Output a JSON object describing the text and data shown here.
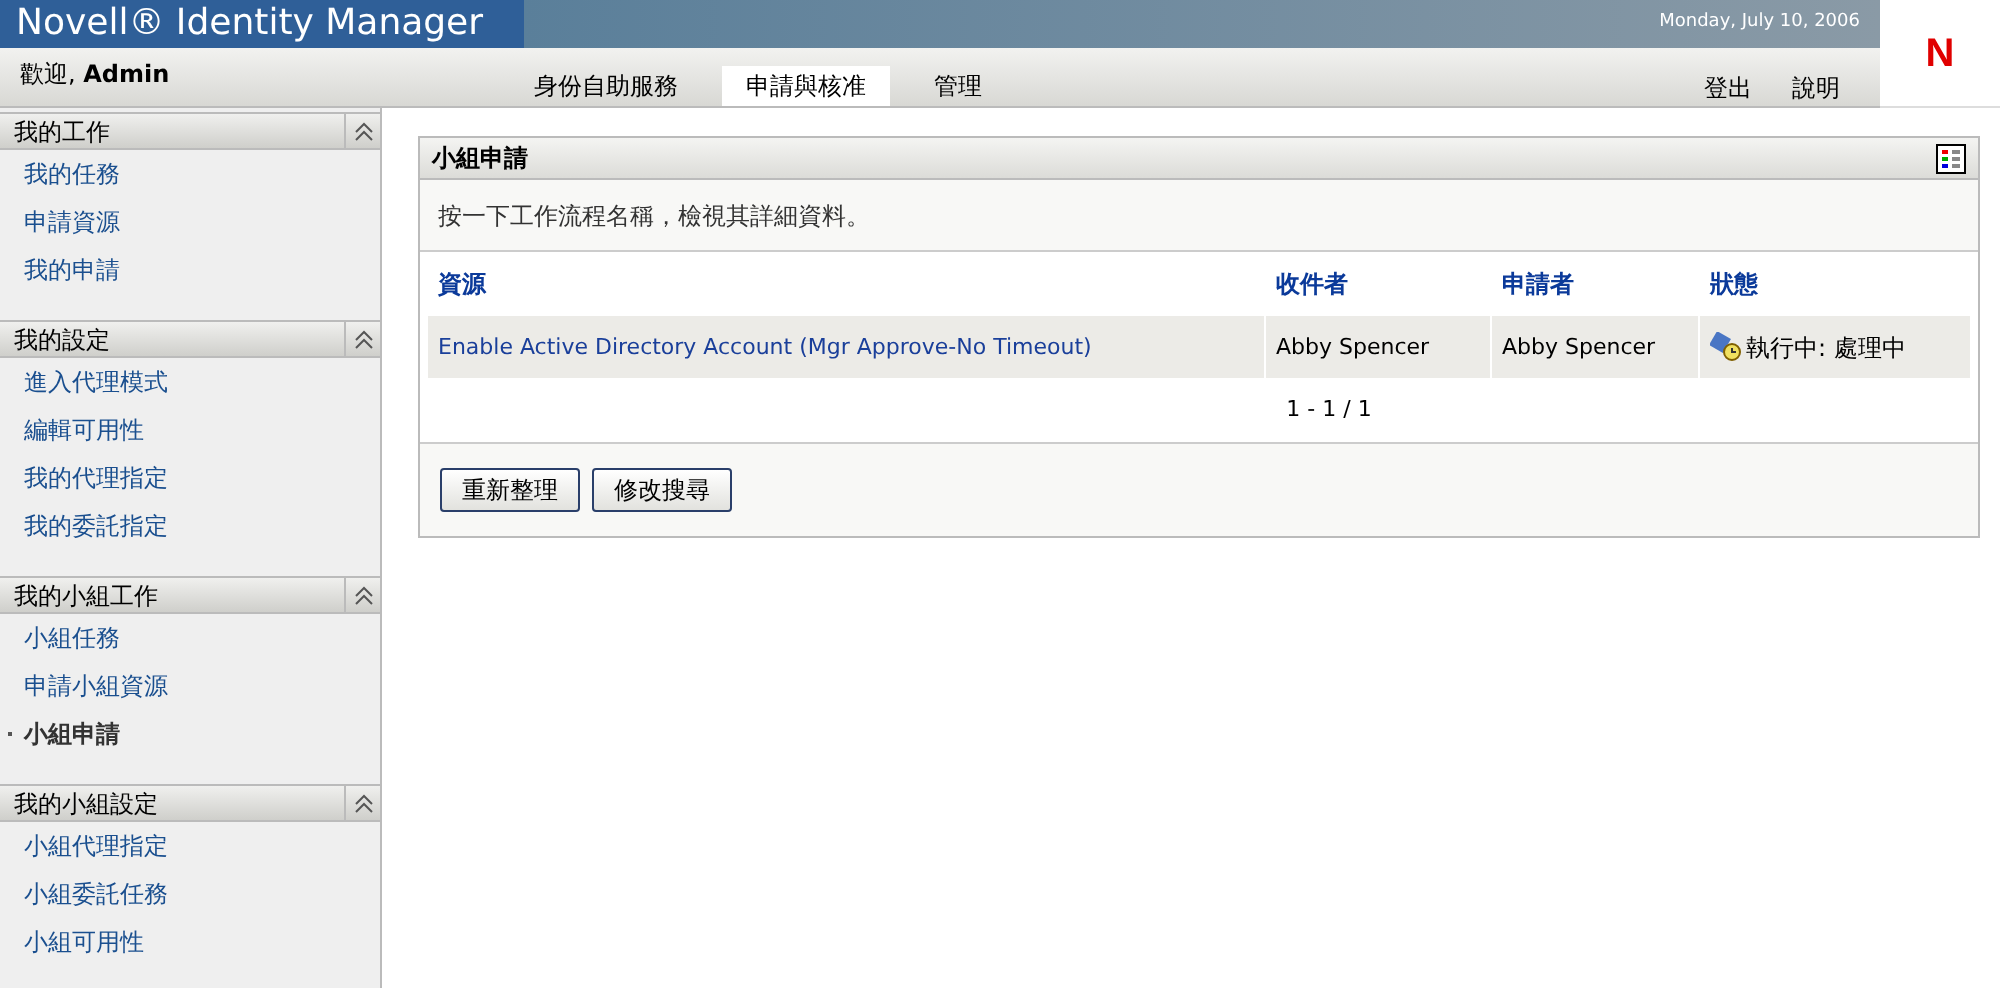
{
  "header": {
    "title": "Novell® Identity Manager",
    "date": "Monday, July 10, 2006",
    "logo": "N",
    "welcome": "歡迎, **Admin**"
  },
  "tabs": [
    {
      "label": "身份自助服務",
      "selected": false
    },
    {
      "label": "申請與核准",
      "selected": true
    },
    {
      "label": "管理",
      "selected": false
    }
  ],
  "header_links": [
    "登出",
    "說明"
  ],
  "sidebar": [
    {
      "title": "我的工作",
      "expanded": true,
      "items": [
        {
          "label": "我的任務",
          "selected": false
        },
        {
          "label": "申請資源",
          "selected": false
        },
        {
          "label": "我的申請",
          "selected": false
        }
      ]
    },
    {
      "title": "我的設定",
      "expanded": true,
      "items": [
        {
          "label": "進入代理模式",
          "selected": false
        },
        {
          "label": "編輯可用性",
          "selected": false
        },
        {
          "label": "我的代理指定",
          "selected": false
        },
        {
          "label": "我的委託指定",
          "selected": false
        }
      ]
    },
    {
      "title": "我的小組工作",
      "expanded": true,
      "items": [
        {
          "label": "小組任務",
          "selected": false
        },
        {
          "label": "申請小組資源",
          "selected": false
        },
        {
          "label": "小組申請",
          "selected": true
        }
      ]
    },
    {
      "title": "我的小組設定",
      "expanded": true,
      "items": [
        {
          "label": "小組代理指定",
          "selected": false
        },
        {
          "label": "小組委託任務",
          "selected": false
        },
        {
          "label": "小組可用性",
          "selected": false
        }
      ]
    }
  ],
  "panel": {
    "title": "小組申請",
    "instructions": "按一下工作流程名稱，檢視其詳細資料。",
    "table": {
      "columns": [
        "資源",
        "收件者",
        "申請者",
        "狀態"
      ],
      "rows": [
        {
          "resource": "Enable Active Directory Account (Mgr Approve-No Timeout)",
          "recipient": "Abby Spencer",
          "requester": "Abby Spencer",
          "status": "執行中: 處理中"
        }
      ]
    },
    "pagination": "1 - 1 / 1",
    "buttons": [
      "重新整理",
      "修改搜尋"
    ]
  }
}
